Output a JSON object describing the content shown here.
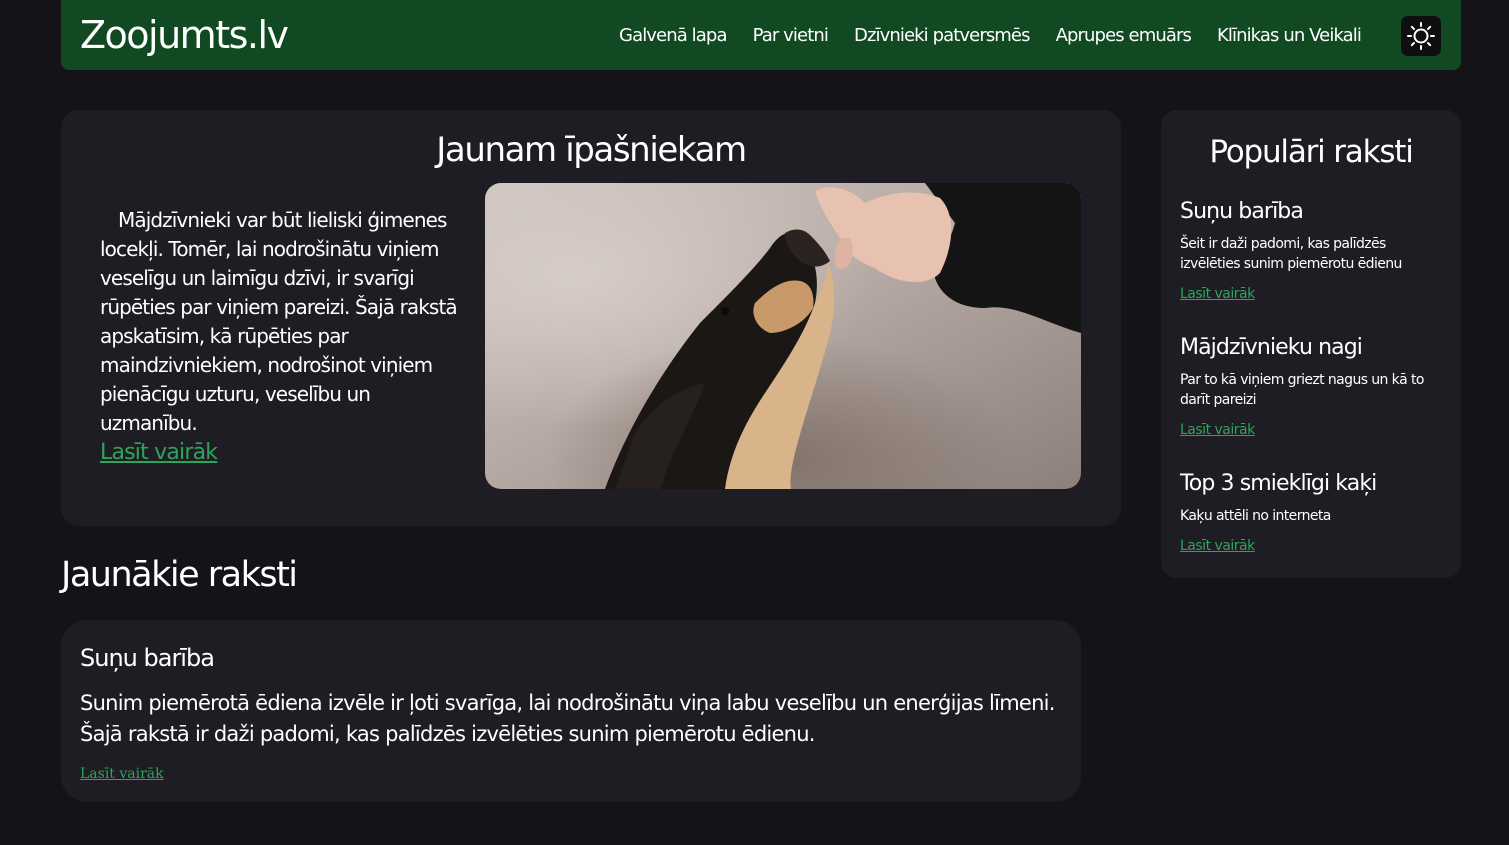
{
  "header": {
    "logo": "Zoojumts.lv",
    "nav": [
      {
        "label": "Galvenā lapa"
      },
      {
        "label": "Par vietni"
      },
      {
        "label": "Dzīvnieki patversmēs"
      },
      {
        "label": "Aprupes emuārs"
      },
      {
        "label": "Klīnikas un Veikali"
      }
    ],
    "theme_icon": "sun-icon"
  },
  "featured": {
    "title": "Jaunam īpašniekam",
    "text": "Mājdzīvnieki var būt lieliski ģimenes locekļi. Tomēr, lai nodrošinātu viņiem veselīgu un laimīgu dzīvi, ir svarīgi rūpēties par viņiem pareizi. Šajā rakstā apskatīsim, kā rūpēties par maindzivniekiem, nodrošinot viņiem pienācīgu uzturu, veselību un uzmanību.",
    "link": "Lasīt vairāk",
    "image": "dog-being-fed-photo"
  },
  "latest": {
    "heading": "Jaunākie raksti",
    "articles": [
      {
        "title": "Suņu barība",
        "text": "Sunim piemērotā ēdiena izvēle ir ļoti svarīga, lai nodrošinātu viņa labu veselību un enerģijas līmeni. Šajā rakstā ir daži padomi, kas palīdzēs izvēlēties sunim piemērotu ēdienu.",
        "link": "Lasīt vairāk"
      }
    ]
  },
  "sidebar": {
    "title": "Populāri raksti",
    "items": [
      {
        "title": "Suņu barība",
        "desc": "Šeit ir daži padomi, kas palīdzēs izvēlēties sunim piemērotu ēdienu",
        "link": "Lasīt vairāk"
      },
      {
        "title": "Mājdzīvnieku nagi",
        "desc": "Par to kā viņiem griezt nagus un kā to darīt pareizi",
        "link": "Lasīt vairāk"
      },
      {
        "title": "Top 3 smieklīgi kaķi",
        "desc": "Kaķu attēli no interneta",
        "link": "Lasīt vairāk"
      }
    ]
  },
  "colors": {
    "background": "#141318",
    "header": "#114a22",
    "panel": "#1e1d24",
    "link": "#2ea45a"
  }
}
